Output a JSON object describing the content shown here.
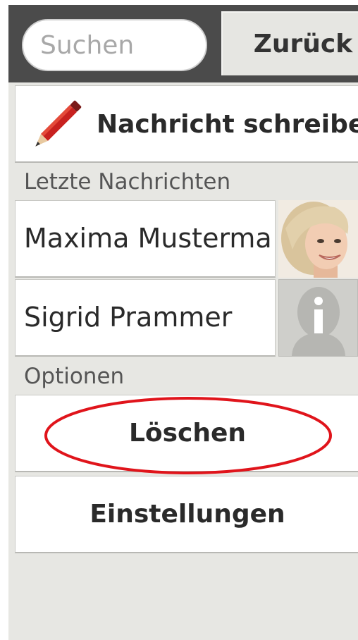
{
  "search": {
    "placeholder": "Suchen"
  },
  "header": {
    "back_label": "Zurück"
  },
  "compose": {
    "label": "Nachricht schreiben",
    "icon": "pencil-icon"
  },
  "recent": {
    "heading": "Letzte Nachrichten",
    "contacts": [
      {
        "name": "Maxima Musterma",
        "avatar": "contact-photo"
      },
      {
        "name": "Sigrid Prammer",
        "avatar": "default-person-icon"
      }
    ]
  },
  "options": {
    "heading": "Optionen",
    "items": [
      {
        "label": "Löschen"
      },
      {
        "label": "Einstellungen"
      }
    ]
  },
  "colors": {
    "topbar": "#4b4b4b",
    "background": "#e7e7e3",
    "highlight": "#e0141b",
    "pencil": "#c8211f"
  }
}
